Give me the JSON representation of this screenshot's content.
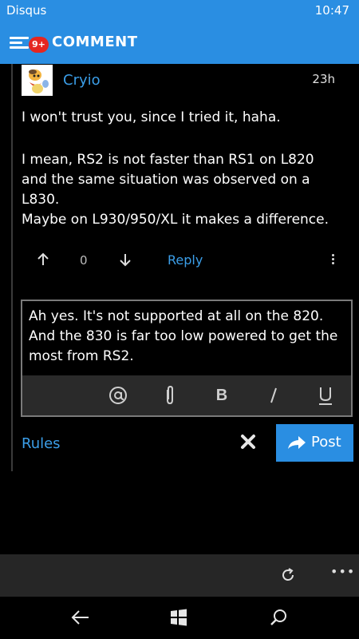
{
  "status_bar": {
    "app_name": "Disqus",
    "time": "10:47"
  },
  "header": {
    "notification_badge": "9+",
    "title": "COMMENT"
  },
  "comment": {
    "author": "Cryio",
    "time_ago": "23h",
    "paragraphs": [
      "I won't trust you, since I tried it, haha.",
      "I mean, RS2 is not faster than RS1 on L820 and the same situation was observed on a L830.",
      "Maybe on L930/950/XL it makes a difference."
    ],
    "vote_count": "0",
    "reply_label": "Reply"
  },
  "composer": {
    "text": "Ah yes. It's not supported at all on the 820. And the 830 is far too low powered to get the most from RS2.",
    "toolbar": [
      "at-icon",
      "attach-icon",
      "bold-icon",
      "italic-icon",
      "underline-icon"
    ]
  },
  "actions": {
    "rules_label": "Rules",
    "post_label": "Post"
  },
  "colors": {
    "accent": "#2a8ee2",
    "link": "#3b9ee8",
    "badge": "#e52620",
    "background": "#000000",
    "toolbar": "#2a2a2a"
  }
}
